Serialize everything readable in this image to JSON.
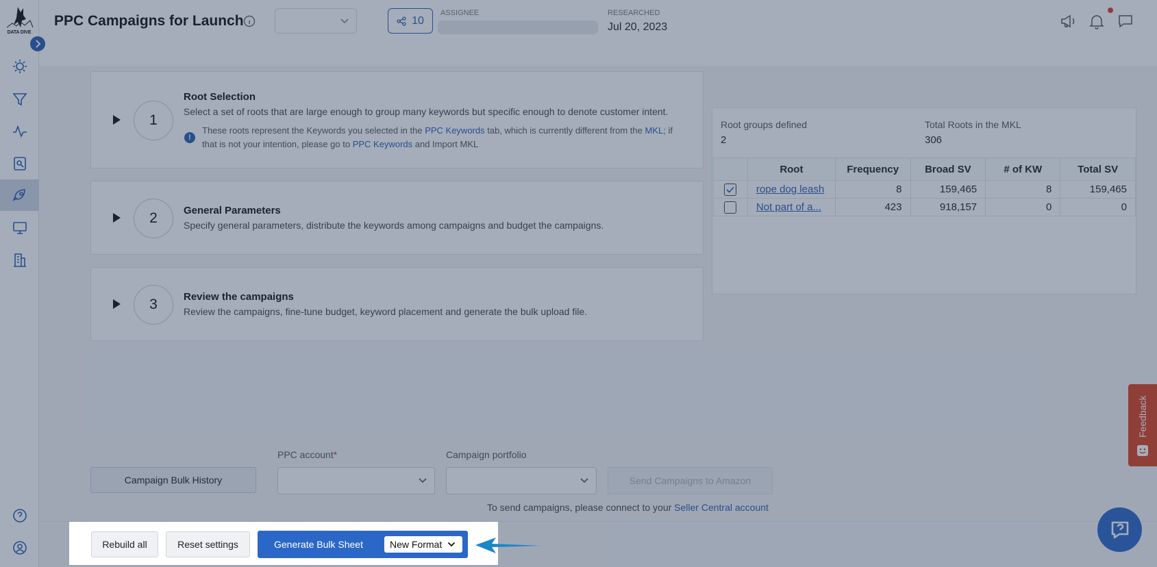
{
  "app": {
    "brand": "DATA DIVE"
  },
  "header": {
    "title": "PPC Campaigns for Launch",
    "share_count": "10",
    "assignee_label": "ASSIGNEE",
    "researched_label": "RESEARCHED",
    "researched_date": "Jul 20, 2023"
  },
  "steps": [
    {
      "number": "1",
      "title": "Root Selection",
      "desc": "Select a set of roots that are large enough to group many keywords but specific enough to denote customer intent."
    },
    {
      "number": "2",
      "title": "General Parameters",
      "desc": "Specify general parameters, distribute the keywords among campaigns and budget the campaigns."
    },
    {
      "number": "3",
      "title": "Review the campaigns",
      "desc": "Review the campaigns, fine-tune budget, keyword placement and generate the bulk upload file."
    }
  ],
  "note": {
    "t1": "These roots represent the Keywords you selected in the ",
    "l1": "PPC Keywords",
    "t2": "  tab, which is currently different from the ",
    "l2": "MKL",
    "t3": "; if that is not your intention, please go to ",
    "l3": "PPC Keywords",
    "t4": " and Import MKL"
  },
  "roots": {
    "groups_label": "Root groups defined",
    "groups_value": "2",
    "total_label": "Total Roots in the MKL",
    "total_value": "306",
    "columns": [
      "Root",
      "Frequency",
      "Broad SV",
      "# of KW",
      "Total SV"
    ],
    "rows": [
      {
        "checked": true,
        "root": "rope dog leash",
        "frequency": "8",
        "broad_sv": "159,465",
        "kw": "8",
        "total_sv": "159,465"
      },
      {
        "checked": false,
        "root": "Not part of a...",
        "frequency": "423",
        "broad_sv": "918,157",
        "kw": "0",
        "total_sv": "0"
      }
    ]
  },
  "bottom": {
    "history_label": "Campaign Bulk History",
    "ppc_account_label": "PPC account",
    "required_mark": "*",
    "portfolio_label": "Campaign portfolio",
    "send_label": "Send Campaigns to Amazon",
    "seller_note": "To send campaigns, please connect to your ",
    "seller_link": "Seller Central account",
    "rebuild_label": "Rebuild all",
    "reset_label": "Reset settings",
    "generate_label": "Generate Bulk Sheet",
    "format_value": "New Format"
  },
  "feedback": {
    "label": "Feedback"
  },
  "colors": {
    "accent": "#2b67c6",
    "link": "#2a5cb0",
    "feedback": "#d9401f",
    "notification": "#e03a2f"
  }
}
